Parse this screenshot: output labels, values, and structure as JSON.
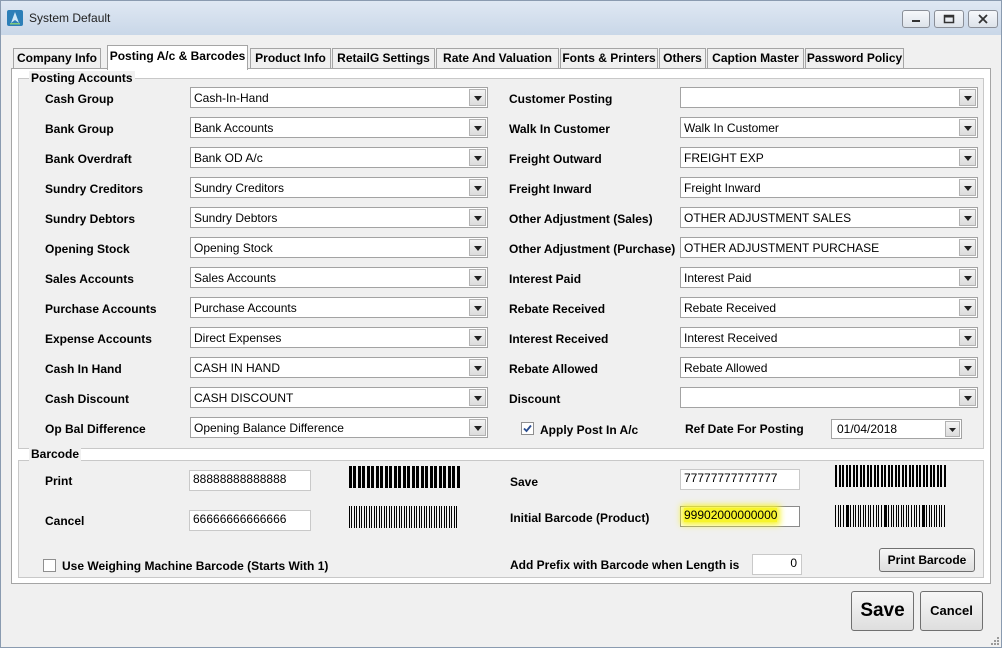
{
  "window": {
    "title": "System Default",
    "icon": "app-logo-icon",
    "controls": [
      "minimize-icon",
      "maximize-icon",
      "close-icon"
    ]
  },
  "tabs": [
    "Company Info",
    "Posting A/c & Barcodes",
    "Product Info",
    "RetailG Settings",
    "Rate And Valuation",
    "Fonts & Printers",
    "Others",
    "Caption Master",
    "Password Policy"
  ],
  "active_tab": "Posting A/c & Barcodes",
  "posting": {
    "legend": "Posting Accounts",
    "left": [
      {
        "label": "Cash Group",
        "value": "Cash-In-Hand"
      },
      {
        "label": "Bank Group",
        "value": "Bank Accounts"
      },
      {
        "label": "Bank Overdraft",
        "value": "Bank OD A/c"
      },
      {
        "label": "Sundry Creditors",
        "value": "Sundry Creditors"
      },
      {
        "label": "Sundry Debtors",
        "value": "Sundry Debtors"
      },
      {
        "label": "Opening Stock",
        "value": "Opening Stock"
      },
      {
        "label": "Sales Accounts",
        "value": "Sales Accounts"
      },
      {
        "label": "Purchase Accounts",
        "value": "Purchase Accounts"
      },
      {
        "label": "Expense Accounts",
        "value": "Direct Expenses"
      },
      {
        "label": "Cash In Hand",
        "value": "CASH IN HAND"
      },
      {
        "label": "Cash Discount",
        "value": "CASH DISCOUNT"
      },
      {
        "label": "Op Bal Difference",
        "value": "Opening Balance Difference"
      }
    ],
    "right": [
      {
        "label": "Customer Posting",
        "value": ""
      },
      {
        "label": "Walk In Customer",
        "value": "Walk In Customer"
      },
      {
        "label": "Freight Outward",
        "value": "FREIGHT EXP"
      },
      {
        "label": "Freight Inward",
        "value": "Freight Inward"
      },
      {
        "label": "Other Adjustment (Sales)",
        "value": "OTHER ADJUSTMENT SALES"
      },
      {
        "label": "Other Adjustment (Purchase)",
        "value": "OTHER ADJUSTMENT PURCHASE"
      },
      {
        "label": "Interest Paid",
        "value": "Interest Paid"
      },
      {
        "label": "Rebate Received",
        "value": "Rebate Received"
      },
      {
        "label": "Interest Received",
        "value": "Interest Received"
      },
      {
        "label": "Rebate Allowed",
        "value": "Rebate Allowed"
      },
      {
        "label": "Discount",
        "value": ""
      }
    ],
    "apply_post_label": "Apply Post In A/c",
    "apply_post_checked": true,
    "ref_date_label": "Ref Date For Posting",
    "ref_date_value": "01/04/2018"
  },
  "barcode": {
    "legend": "Barcode",
    "print_label": "Print",
    "print_value": "88888888888888",
    "cancel_label": "Cancel",
    "cancel_value": "66666666666666",
    "save_label": "Save",
    "save_value": "77777777777777",
    "initial_label": "Initial Barcode (Product)",
    "initial_value": "99902000000000",
    "weighing_label": "Use Weighing Machine Barcode (Starts With 1)",
    "weighing_checked": false,
    "prefix_label": "Add Prefix with Barcode when Length is",
    "prefix_value": "0",
    "print_barcode_button": "Print Barcode"
  },
  "buttons": {
    "save": "Save",
    "cancel": "Cancel"
  },
  "colors": {
    "highlight": "#f7f42b",
    "title_bar": "#c9d7e8",
    "panel": "#f0f0f0"
  }
}
